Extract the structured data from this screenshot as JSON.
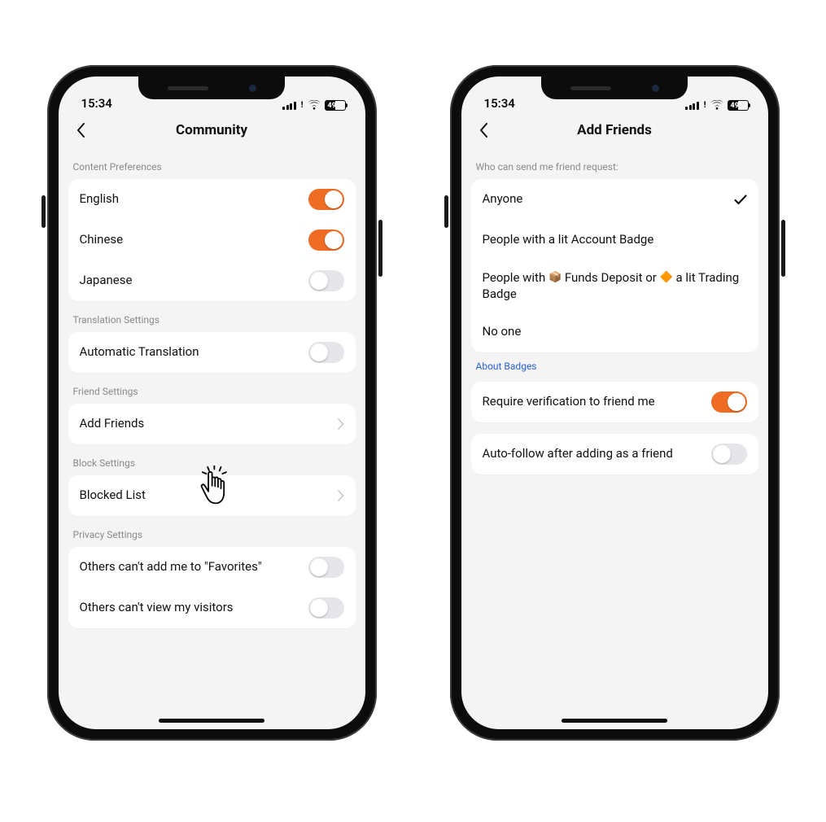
{
  "status": {
    "time": "15:34",
    "battery": "49"
  },
  "left": {
    "title": "Community",
    "sections": {
      "content_pref": {
        "header": "Content Preferences",
        "english": "English",
        "chinese": "Chinese",
        "japanese": "Japanese"
      },
      "translation": {
        "header": "Translation Settings",
        "auto": "Automatic Translation"
      },
      "friend": {
        "header": "Friend Settings",
        "add_friends": "Add Friends"
      },
      "block": {
        "header": "Block Settings",
        "blocked_list": "Blocked List"
      },
      "privacy": {
        "header": "Privacy Settings",
        "favorites": "Others can't add me to \"Favorites\"",
        "visitors": "Others can't view my visitors"
      }
    }
  },
  "right": {
    "title": "Add Friends",
    "header": "Who can send me friend request:",
    "options": {
      "anyone": "Anyone",
      "lit_badge": "People with a lit Account Badge",
      "funds_pre": "People with ",
      "funds_mid": " Funds Deposit or ",
      "funds_post": " a lit Trading Badge",
      "noone": "No one"
    },
    "about_badges": "About Badges",
    "require_verify": "Require verification to friend me",
    "auto_follow": "Auto-follow after adding as a friend"
  },
  "toggles": {
    "english": true,
    "chinese": true,
    "japanese": false,
    "auto_translation": false,
    "favorites": false,
    "visitors": false,
    "require_verify": true,
    "auto_follow": false
  },
  "selected_option": "anyone"
}
